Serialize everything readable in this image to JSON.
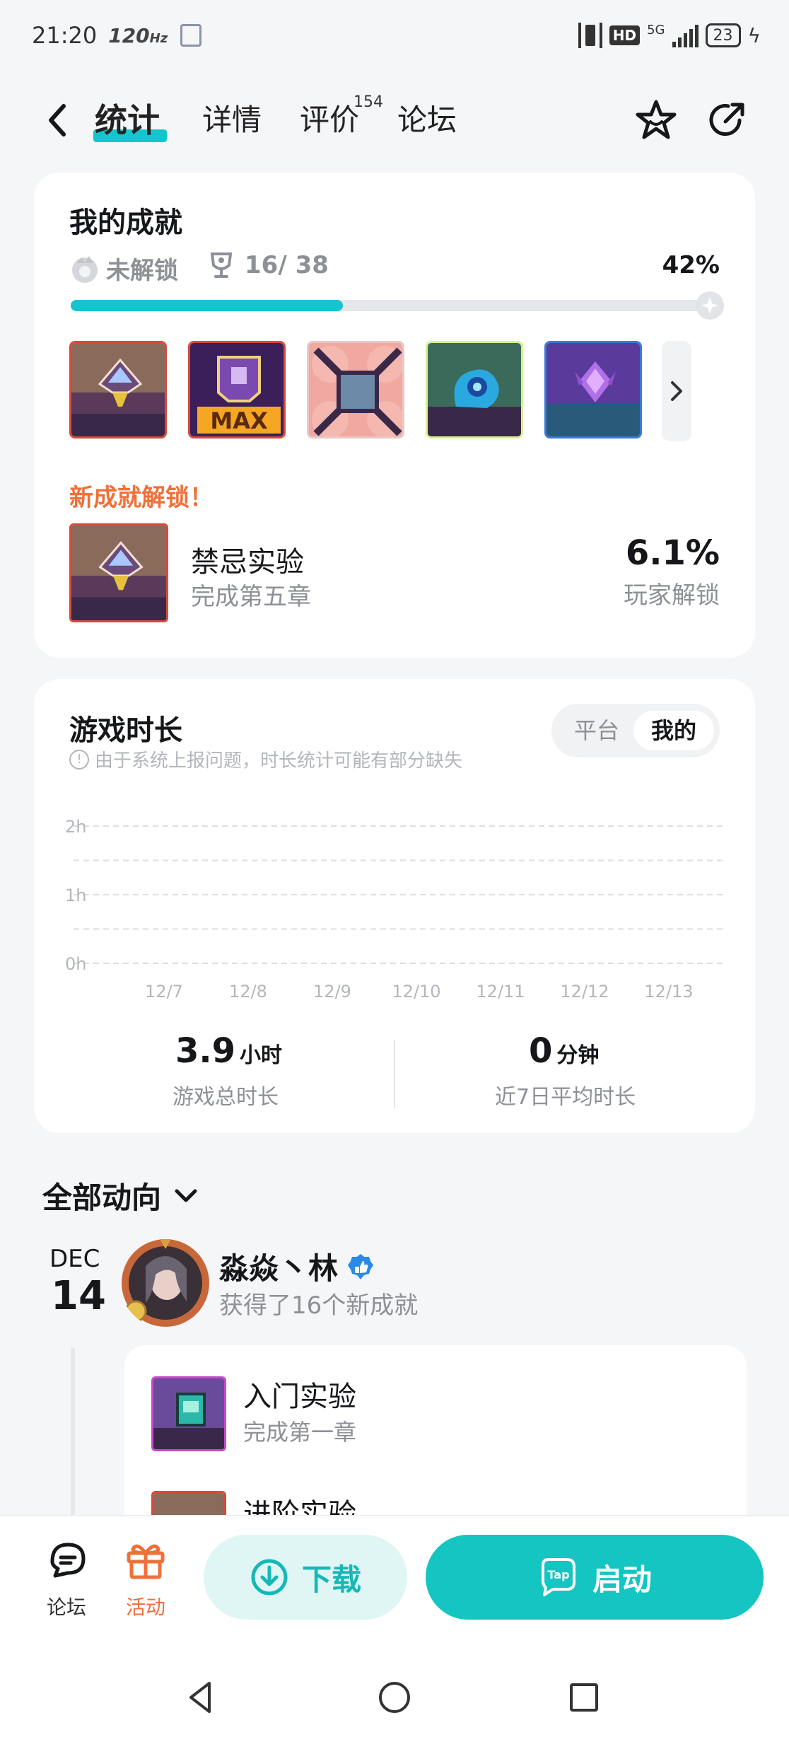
{
  "status_bar": {
    "time": "21:20",
    "refresh": "120",
    "battery": "23",
    "network": "5G",
    "hd": "HD"
  },
  "nav": {
    "tabs": [
      {
        "label": "统计",
        "active": true
      },
      {
        "label": "详情",
        "active": false
      },
      {
        "label": "评价",
        "active": false,
        "badge": "154"
      },
      {
        "label": "论坛",
        "active": false
      }
    ]
  },
  "achievements": {
    "title": "我的成就",
    "locked_label": "未解锁",
    "count": "16/ 38",
    "percent": "42%",
    "progress_fraction": 0.42,
    "new_label": "新成就解锁！",
    "new_item": {
      "name": "禁忌实验",
      "desc": "完成第五章",
      "rate": "6.1%",
      "rate_label": "玩家解锁"
    }
  },
  "playtime": {
    "title": "游戏时长",
    "toggle": [
      "平台",
      "我的"
    ],
    "notice": "由于系统上报问题，时长统计可能有部分缺失",
    "total_value": "3.9",
    "total_unit": "小时",
    "total_label": "游戏总时长",
    "avg_value": "0",
    "avg_unit": "分钟",
    "avg_label": "近7日平均时长"
  },
  "chart_data": {
    "type": "bar",
    "categories": [
      "12/7",
      "12/8",
      "12/9",
      "12/10",
      "12/11",
      "12/12",
      "12/13"
    ],
    "values": [
      0,
      0,
      0,
      0,
      0,
      0,
      0
    ],
    "y_ticks": [
      "2h",
      "1h",
      "0h"
    ],
    "ylim": [
      0,
      2
    ],
    "grid": true
  },
  "feed": {
    "title": "全部动向",
    "month": "DEC",
    "day": "14",
    "user_name": "淼焱丶林",
    "action": "获得了16个新成就",
    "items": [
      {
        "name": "入门实验",
        "desc": "完成第一章"
      },
      {
        "name": "进阶实验",
        "desc": ""
      }
    ]
  },
  "bottom_bar": {
    "forum": "论坛",
    "activity": "活动",
    "download": "下载",
    "launch": "启动",
    "tap_logo": "Tap"
  },
  "colors": {
    "accent": "#15c5c2",
    "orange": "#f0703a"
  }
}
